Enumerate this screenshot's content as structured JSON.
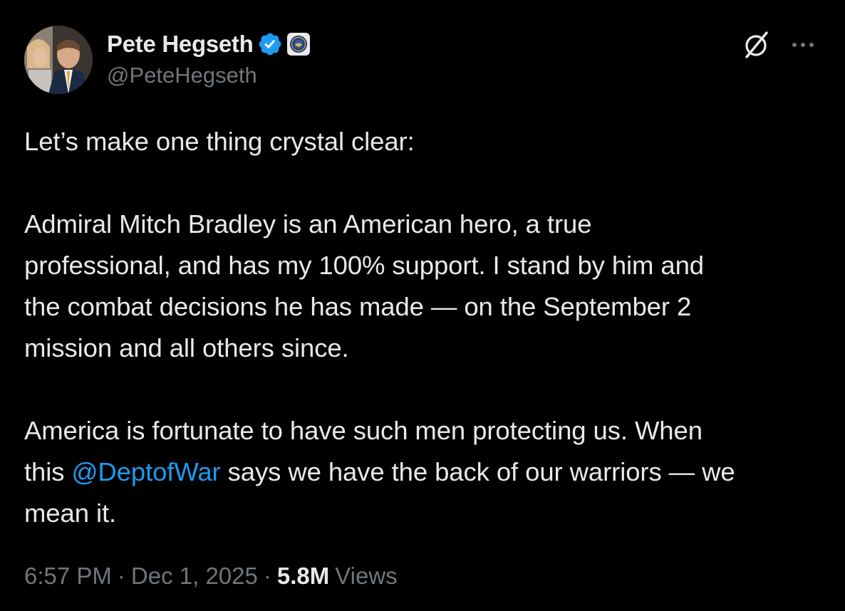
{
  "author": {
    "display_name": "Pete Hegseth",
    "handle": "@PeteHegseth",
    "verified": true,
    "affiliate_badge": "dod-seal-icon"
  },
  "actions": {
    "grok_icon": "grok-slash-icon",
    "more_icon": "more-horizontal-icon"
  },
  "tweet": {
    "line1": "Let’s make one thing crystal clear:",
    "para2_line1": "Admiral Mitch Bradley is an American hero, a true",
    "para2_line2": "professional, and has my 100% support. I stand by him and",
    "para2_line3": "the combat decisions he has made — on the September 2",
    "para2_line4": "mission and all others since.",
    "para3_line1": "America is fortunate to have such men protecting us. When",
    "para3_line2_prefix": "this ",
    "para3_mention": "@DeptofWar",
    "para3_line2_suffix": " says we have the back of our warriors — we",
    "para3_line3": "mean it."
  },
  "meta": {
    "time": "6:57 PM",
    "separator": "·",
    "date": "Dec 1, 2025",
    "views_count": "5.8M",
    "views_label": "Views"
  },
  "colors": {
    "background": "#000000",
    "text": "#e7e9ea",
    "secondary": "#71767b",
    "link": "#1d9bf0",
    "verified": "#1d9bf0"
  }
}
